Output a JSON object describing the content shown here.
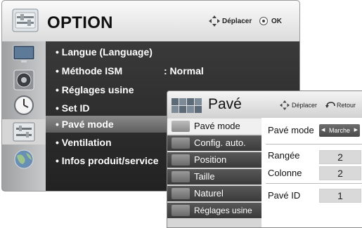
{
  "option_menu": {
    "title": "OPTION",
    "hint_move": "Déplacer",
    "hint_ok": "OK",
    "items": [
      {
        "label": "• Langue (Language)",
        "value": ""
      },
      {
        "label": "• Méthode ISM",
        "value": ": Normal"
      },
      {
        "label": "• Réglages usine",
        "value": ""
      },
      {
        "label": "• Set ID",
        "value": ""
      },
      {
        "label": "• Pavé mode",
        "value": ""
      },
      {
        "label": "• Ventilation",
        "value": ""
      },
      {
        "label": "• Infos produit/service",
        "value": ""
      }
    ],
    "selected_index": 4,
    "sidebar_icons": [
      "monitor-icon",
      "speaker-icon",
      "clock-icon",
      "option-icon",
      "globe-icon"
    ],
    "active_sidebar_index": 3
  },
  "pave_menu": {
    "title": "Pavé",
    "hint_move": "Déplacer",
    "hint_back": "Retour",
    "items": [
      "Pavé mode",
      "Config. auto.",
      "Position",
      "Taille",
      "Naturel",
      "Réglages usine"
    ],
    "active_index": 0,
    "settings": {
      "mode_label": "Pavé mode",
      "mode_value": "Marche",
      "rows_label": "Rangée",
      "rows_value": "2",
      "columns_label": "Colonne",
      "columns_value": "2",
      "id_label": "Pavé ID",
      "id_value": "1"
    }
  }
}
